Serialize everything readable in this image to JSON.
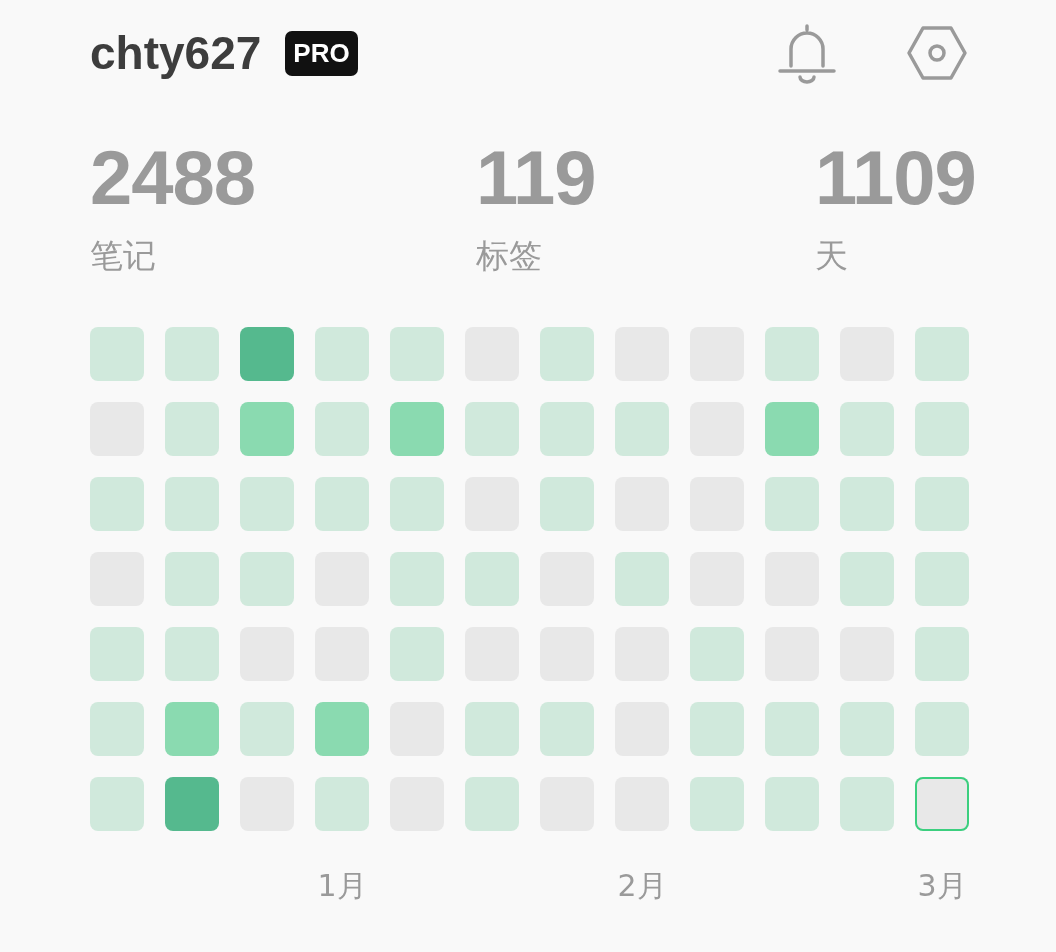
{
  "profile": {
    "username": "chty627",
    "badge": "PRO"
  },
  "stats": [
    {
      "value": "2488",
      "label": "笔记"
    },
    {
      "value": "119",
      "label": "标签"
    },
    {
      "value": "1109",
      "label": "天"
    }
  ],
  "heatmap": {
    "weeks": [
      {
        "days": [
          {
            "kind": "low",
            "today": false
          },
          {
            "kind": "none",
            "today": false
          },
          {
            "kind": "low",
            "today": false
          },
          {
            "kind": "none",
            "today": false
          },
          {
            "kind": "low",
            "today": false
          },
          {
            "kind": "low",
            "today": false
          },
          {
            "kind": "low",
            "today": false
          }
        ]
      },
      {
        "days": [
          {
            "kind": "low",
            "today": false
          },
          {
            "kind": "low",
            "today": false
          },
          {
            "kind": "low",
            "today": false
          },
          {
            "kind": "low",
            "today": false
          },
          {
            "kind": "low",
            "today": false
          },
          {
            "kind": "mid",
            "today": false
          },
          {
            "kind": "high",
            "today": false
          }
        ]
      },
      {
        "days": [
          {
            "kind": "high",
            "today": false
          },
          {
            "kind": "mid",
            "today": false
          },
          {
            "kind": "low",
            "today": false
          },
          {
            "kind": "low",
            "today": false
          },
          {
            "kind": "none",
            "today": false
          },
          {
            "kind": "low",
            "today": false
          },
          {
            "kind": "none",
            "today": false
          }
        ]
      },
      {
        "month": "1月",
        "days": [
          {
            "kind": "low",
            "today": false
          },
          {
            "kind": "low",
            "today": false
          },
          {
            "kind": "low",
            "today": false
          },
          {
            "kind": "none",
            "today": false
          },
          {
            "kind": "none",
            "today": false
          },
          {
            "kind": "mid",
            "today": false
          },
          {
            "kind": "low",
            "today": false
          }
        ]
      },
      {
        "days": [
          {
            "kind": "low",
            "today": false
          },
          {
            "kind": "mid",
            "today": false
          },
          {
            "kind": "low",
            "today": false
          },
          {
            "kind": "low",
            "today": false
          },
          {
            "kind": "low",
            "today": false
          },
          {
            "kind": "none",
            "today": false
          },
          {
            "kind": "none",
            "today": false
          }
        ]
      },
      {
        "days": [
          {
            "kind": "none",
            "today": false
          },
          {
            "kind": "low",
            "today": false
          },
          {
            "kind": "none",
            "today": false
          },
          {
            "kind": "low",
            "today": false
          },
          {
            "kind": "none",
            "today": false
          },
          {
            "kind": "low",
            "today": false
          },
          {
            "kind": "low",
            "today": false
          }
        ]
      },
      {
        "days": [
          {
            "kind": "low",
            "today": false
          },
          {
            "kind": "low",
            "today": false
          },
          {
            "kind": "low",
            "today": false
          },
          {
            "kind": "none",
            "today": false
          },
          {
            "kind": "none",
            "today": false
          },
          {
            "kind": "low",
            "today": false
          },
          {
            "kind": "none",
            "today": false
          }
        ]
      },
      {
        "month": "2月",
        "days": [
          {
            "kind": "none",
            "today": false
          },
          {
            "kind": "low",
            "today": false
          },
          {
            "kind": "none",
            "today": false
          },
          {
            "kind": "low",
            "today": false
          },
          {
            "kind": "none",
            "today": false
          },
          {
            "kind": "none",
            "today": false
          },
          {
            "kind": "none",
            "today": false
          }
        ]
      },
      {
        "days": [
          {
            "kind": "none",
            "today": false
          },
          {
            "kind": "none",
            "today": false
          },
          {
            "kind": "none",
            "today": false
          },
          {
            "kind": "none",
            "today": false
          },
          {
            "kind": "low",
            "today": false
          },
          {
            "kind": "low",
            "today": false
          },
          {
            "kind": "low",
            "today": false
          }
        ]
      },
      {
        "days": [
          {
            "kind": "low",
            "today": false
          },
          {
            "kind": "mid",
            "today": false
          },
          {
            "kind": "low",
            "today": false
          },
          {
            "kind": "none",
            "today": false
          },
          {
            "kind": "none",
            "today": false
          },
          {
            "kind": "low",
            "today": false
          },
          {
            "kind": "low",
            "today": false
          }
        ]
      },
      {
        "days": [
          {
            "kind": "none",
            "today": false
          },
          {
            "kind": "low",
            "today": false
          },
          {
            "kind": "low",
            "today": false
          },
          {
            "kind": "low",
            "today": false
          },
          {
            "kind": "none",
            "today": false
          },
          {
            "kind": "low",
            "today": false
          },
          {
            "kind": "low",
            "today": false
          }
        ]
      },
      {
        "month": "3月",
        "days": [
          {
            "kind": "low",
            "today": false
          },
          {
            "kind": "low",
            "today": false
          },
          {
            "kind": "low",
            "today": false
          },
          {
            "kind": "low",
            "today": false
          },
          {
            "kind": "low",
            "today": false
          },
          {
            "kind": "low",
            "today": false
          },
          {
            "kind": "none",
            "today": true
          }
        ]
      }
    ]
  }
}
